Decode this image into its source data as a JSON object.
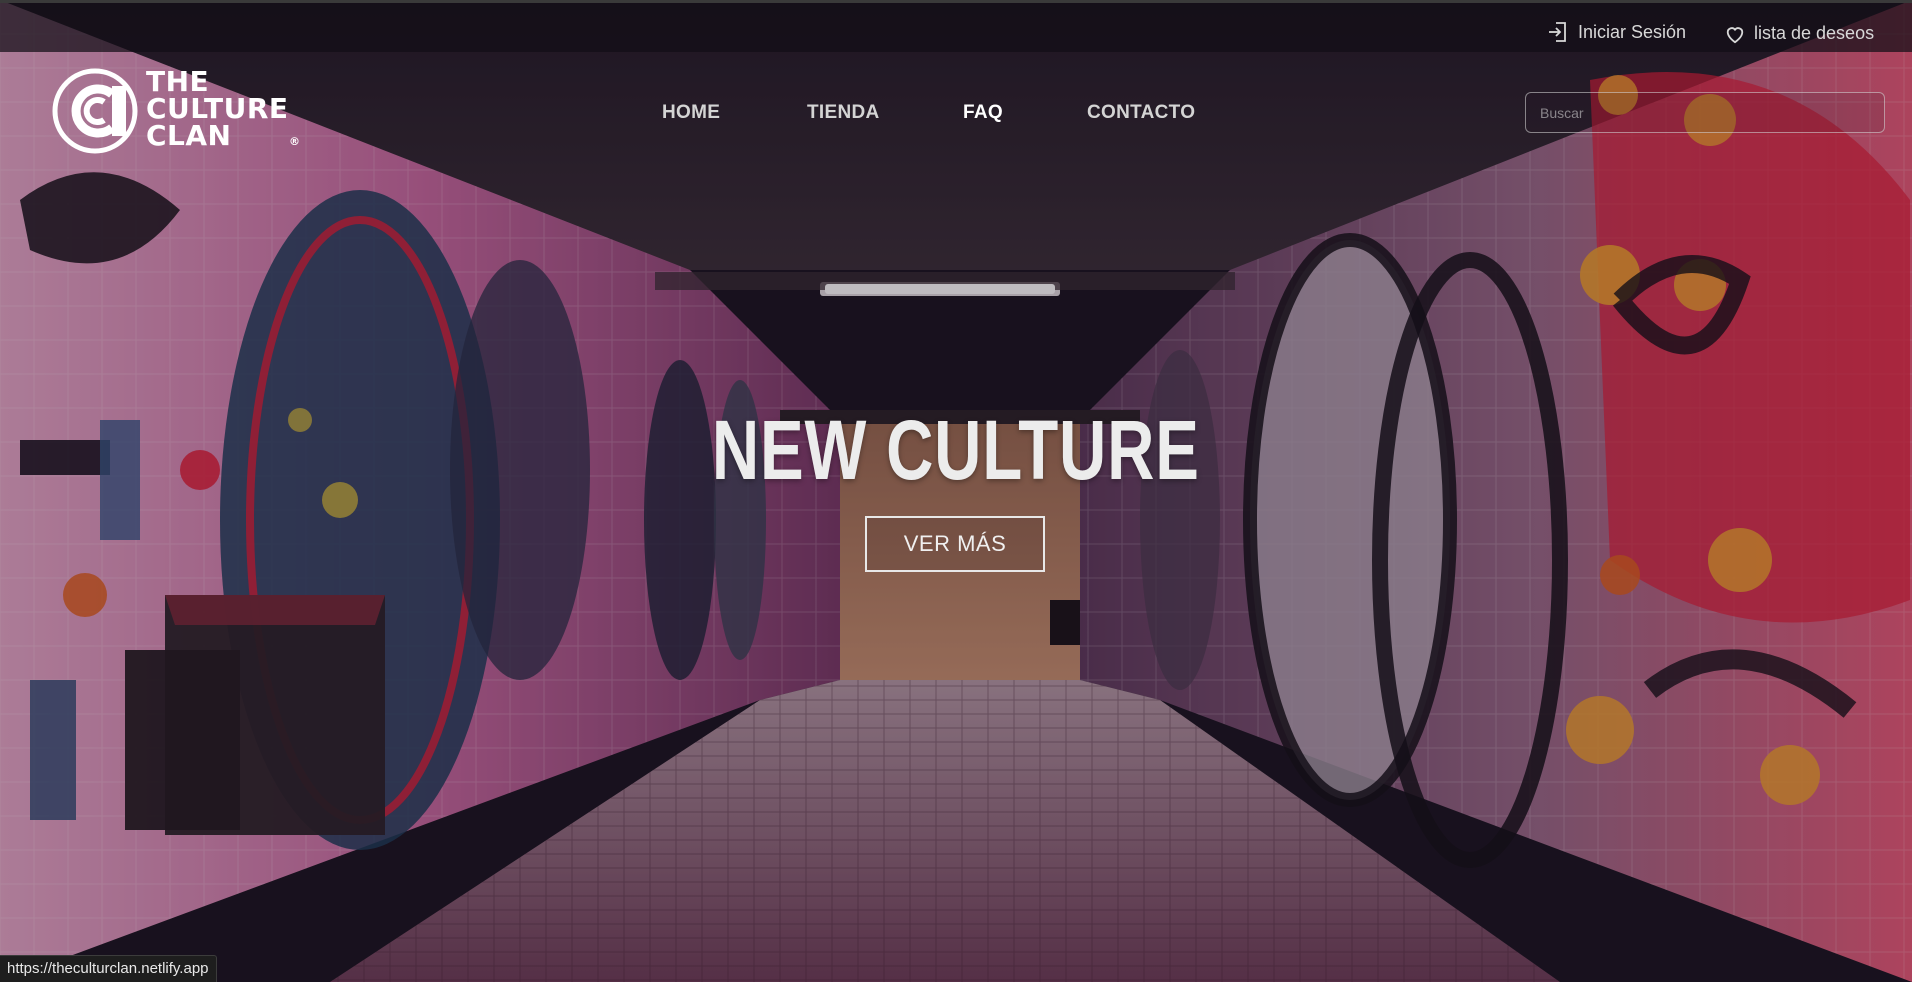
{
  "topbar": {
    "login_label": "Iniciar Sesión",
    "wishlist_label": "lista de deseos"
  },
  "logo": {
    "line1": "THE",
    "line2": "CULTURE",
    "line3": "CLAN",
    "registered": "®"
  },
  "nav": {
    "items": [
      {
        "label": "HOME"
      },
      {
        "label": "TIENDA"
      },
      {
        "label": "FAQ"
      },
      {
        "label": "CONTACTO"
      }
    ],
    "active": "FAQ"
  },
  "search": {
    "placeholder": "Buscar",
    "value": ""
  },
  "hero": {
    "title": "NEW CULTURE",
    "button_label": "VER MÁS"
  },
  "status_bar": {
    "url": "https://theculturclan.netlify.app"
  },
  "colors": {
    "topbar_bg": "#120e16",
    "text_light": "#ececec",
    "graffiti_pink": "#e84a8a",
    "graffiti_red": "#e0203a",
    "graffiti_orange": "#f0a030"
  },
  "icons": {
    "login": "login-icon",
    "wishlist": "heart-icon",
    "logo": "culture-clan-logo"
  }
}
